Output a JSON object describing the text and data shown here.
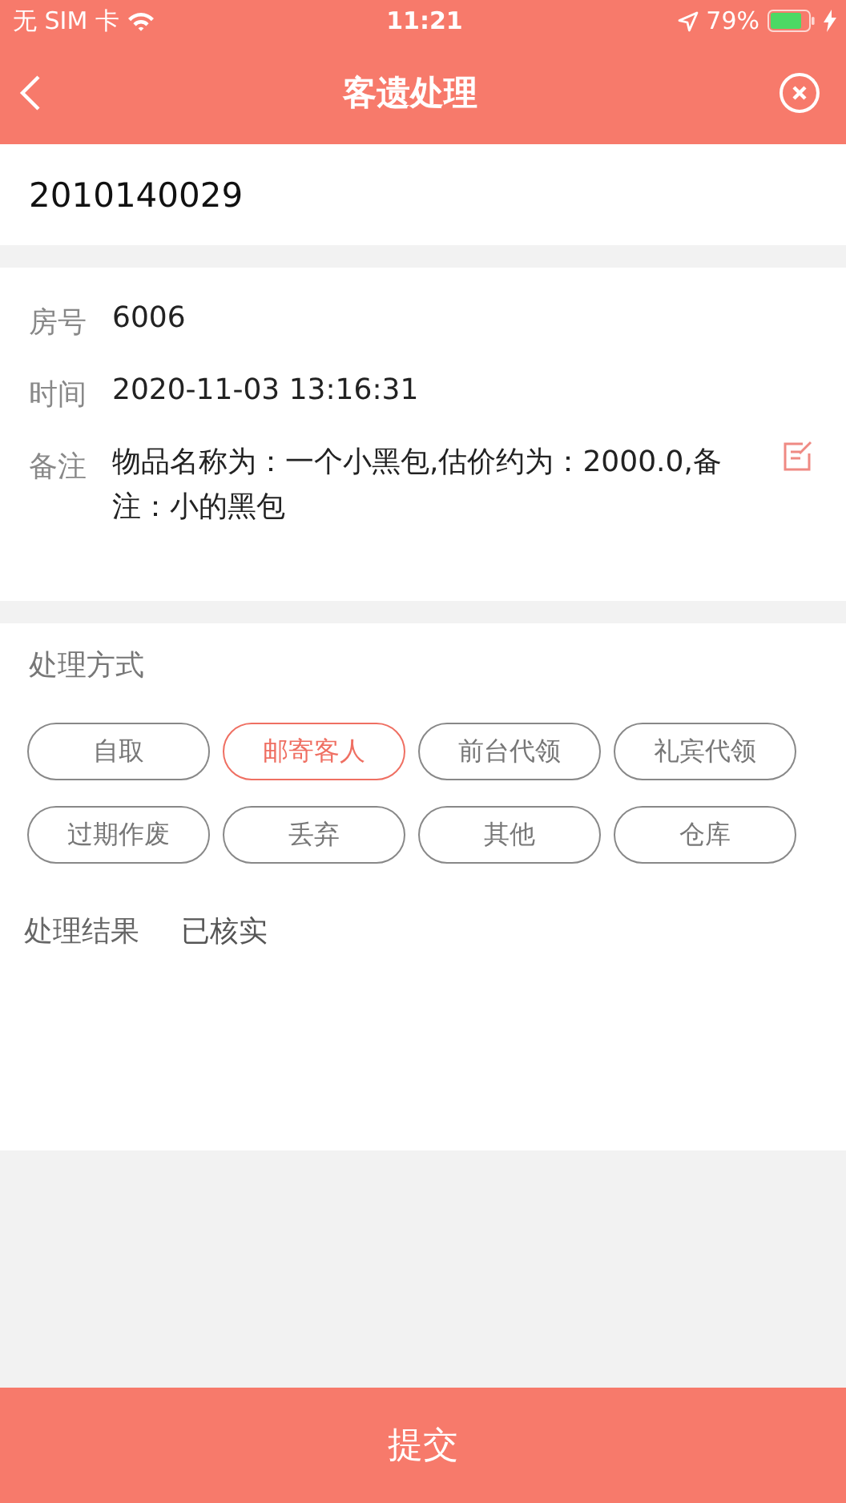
{
  "status_bar": {
    "carrier": "无 SIM 卡",
    "time": "11:21",
    "battery": "79%"
  },
  "nav": {
    "title": "客遗处理"
  },
  "code_field": {
    "value": "2010140029"
  },
  "details": [
    {
      "kind": "text",
      "label": "房号",
      "value": "6006"
    },
    {
      "kind": "text",
      "label": "时间",
      "value": "2020-11-03 13:16:31"
    },
    {
      "kind": "note",
      "label": "备注",
      "value": "物品名称为：一个小黑包,估价约为：2000.0,备注：小的黑包"
    }
  ],
  "handling": {
    "label": "处理方式",
    "options": [
      {
        "label": "自取",
        "selected": false
      },
      {
        "label": "邮寄客人",
        "selected": true
      },
      {
        "label": "前台代领",
        "selected": false
      },
      {
        "label": "礼宾代领",
        "selected": false
      },
      {
        "label": "过期作废",
        "selected": false
      },
      {
        "label": "丢弃",
        "selected": false
      },
      {
        "label": "其他",
        "selected": false
      },
      {
        "label": "仓库",
        "selected": false
      }
    ]
  },
  "result": {
    "label": "处理结果",
    "value": "已核实"
  },
  "submit": "提交"
}
